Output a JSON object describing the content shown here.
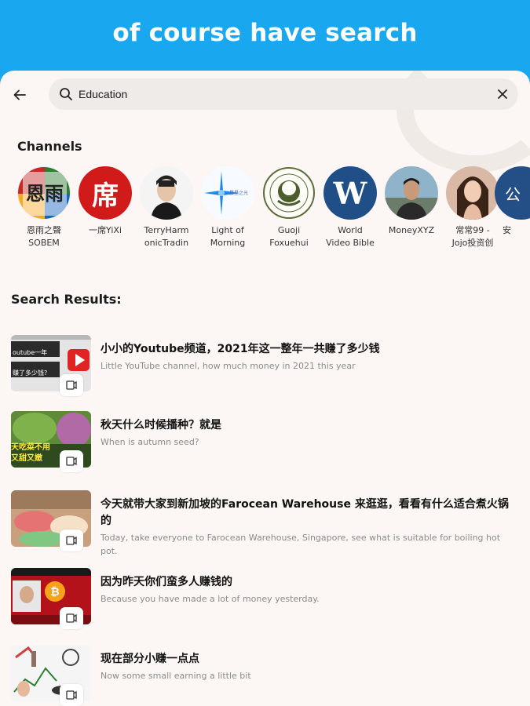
{
  "banner": {
    "title": "of course have search"
  },
  "search": {
    "value": "Education"
  },
  "channels": {
    "title": "Channels",
    "items": [
      {
        "name": "恩雨之聲\nSOBEM",
        "avatar_icon": "sobem-logo"
      },
      {
        "name": "一席YiXi",
        "avatar_icon": "yixi-logo",
        "avatar_text": "席"
      },
      {
        "name": "TerryHarm\nonicTradin",
        "avatar_icon": "person-photo"
      },
      {
        "name": "Light of\nMorning",
        "avatar_icon": "star-logo"
      },
      {
        "name": "Guoji\nFoxuehui",
        "avatar_icon": "seal-logo"
      },
      {
        "name": "World\nVideo Bible",
        "avatar_icon": "w-logo",
        "avatar_text": "W"
      },
      {
        "name": "MoneyXYZ",
        "avatar_icon": "person-photo"
      },
      {
        "name": "常常99 -\nJojo投资创",
        "avatar_icon": "person-photo"
      },
      {
        "name": "安",
        "avatar_icon": "blue-logo",
        "avatar_text": "公"
      }
    ]
  },
  "results": {
    "title": "Search Results:",
    "items": [
      {
        "title": "小小的Youtube频道，2021年这一整年一共赚了多少钱",
        "subtitle": "Little YouTube channel, how much money in 2021 this year",
        "thumb_text": "outube一年\n赚了多少钱?"
      },
      {
        "title": "秋天什么时候播种？就是",
        "subtitle": "When is autumn seed?",
        "thumb_text": "天吃菜不用\n又甜又嫩"
      },
      {
        "title": "今天就带大家到新加坡的Farocean Warehouse 来逛逛，看看有什么适合煮火锅的",
        "subtitle": "Today, take everyone to Farocean Warehouse, Singapore, see what is suitable for boiling hot pot.",
        "thumb_text": ""
      },
      {
        "title": "因为昨天你们蛮多人赚钱的",
        "subtitle": "Because you have made a lot of money yesterday.",
        "thumb_text": ""
      },
      {
        "title": "现在部分小赚一点点",
        "subtitle": "Now some small earning a little bit",
        "thumb_text": ""
      }
    ]
  },
  "colors": {
    "banner": "#19a7f0",
    "screen_bg": "#fcf7f4",
    "search_bg": "#efebe8"
  }
}
